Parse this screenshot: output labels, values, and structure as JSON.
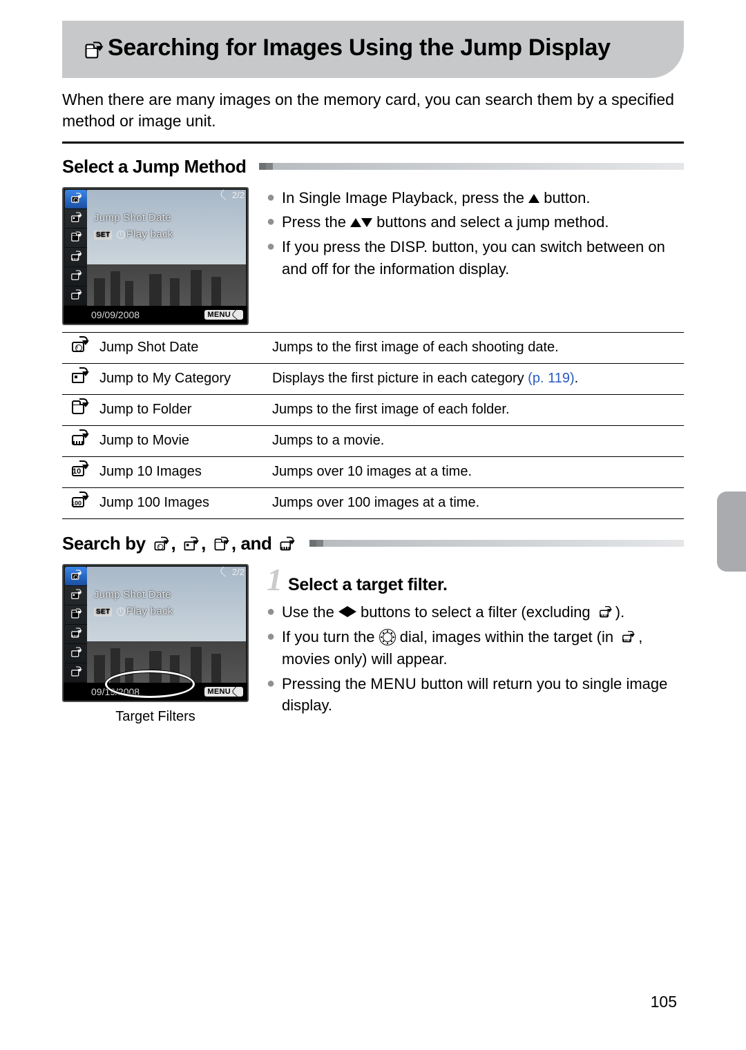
{
  "page_number": "105",
  "title": "Searching for Images Using the Jump Display",
  "intro": "When there are many images on the memory card, you can search them by a specified method or image unit.",
  "section1": {
    "heading": "Select a Jump Method",
    "lcd": {
      "counter": "2/2",
      "line1": "Jump Shot Date",
      "line2_set": "SET",
      "line2_rest": "Play back",
      "date": "09/09/2008",
      "menu": "MENU"
    },
    "bullets": {
      "b1a": "In Single Image Playback, press the ",
      "b1b": " button.",
      "b2a": "Press the ",
      "b2b": " buttons and select a jump method.",
      "b3a": "If you press the ",
      "b3_disp": "DISP.",
      "b3b": " button, you can switch between on and off for the information display."
    }
  },
  "jump_table": [
    {
      "name": "Jump Shot Date",
      "desc": "Jumps to the first image of each shooting date."
    },
    {
      "name": "Jump to My Category",
      "desc": "Displays the first picture in each category ",
      "link": "(p. 119)",
      "suffix": "."
    },
    {
      "name": "Jump to Folder",
      "desc": "Jumps to the first image of each folder."
    },
    {
      "name": "Jump to Movie",
      "desc": "Jumps to a movie."
    },
    {
      "name": "Jump 10 Images",
      "desc": "Jumps over 10 images at a time.",
      "sub": "10"
    },
    {
      "name": "Jump 100 Images",
      "desc": "Jumps over 100 images at a time.",
      "sub": "100"
    }
  ],
  "section2": {
    "heading_prefix": "Search by ",
    "heading_suffix": ", and ",
    "lcd": {
      "counter": "2/2",
      "line1": "Jump Shot Date",
      "line2_set": "SET",
      "line2_rest": "Play back",
      "date": "09/19/2008",
      "menu": "MENU"
    },
    "target_caption": "Target Filters",
    "step_num": "1",
    "step_title": "Select a target filter.",
    "bullets": {
      "b1a": "Use the ",
      "b1b": " buttons to select a filter (excluding ",
      "b1c": ").",
      "b2a": "If you turn the ",
      "b2b": " dial, images within the target (in ",
      "b2c": ", movies only) will appear.",
      "b3a": "Pressing the ",
      "b3_menu": "MENU",
      "b3b": " button will return you to single image display."
    }
  }
}
